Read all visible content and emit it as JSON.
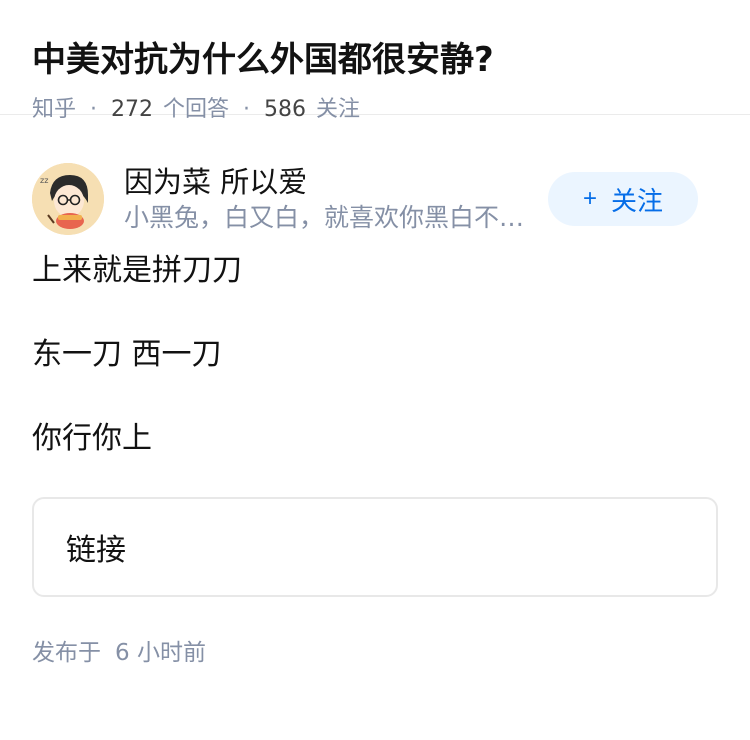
{
  "question": {
    "title": "中美对抗为什么外国都很安静?",
    "source": "知乎",
    "answer_count": "272",
    "answer_label": "个回答",
    "follower_count": "586",
    "follower_label": "关注"
  },
  "answer": {
    "author": {
      "name": "因为菜 所以爱",
      "bio": "小黑兔，白又白，就喜欢你黑白不分明",
      "follow_label": "关注",
      "follow_icon": "plus-icon"
    },
    "paragraphs": [
      "上来就是拼刀刀",
      "东一刀 西一刀",
      "你行你上"
    ],
    "link_label": "链接",
    "publish_label": "发布于",
    "publish_time": "6 小时前"
  },
  "colors": {
    "accent": "#056de8",
    "accent_bg": "#ebf5ff",
    "meta": "#8590a6",
    "text": "#121212"
  }
}
